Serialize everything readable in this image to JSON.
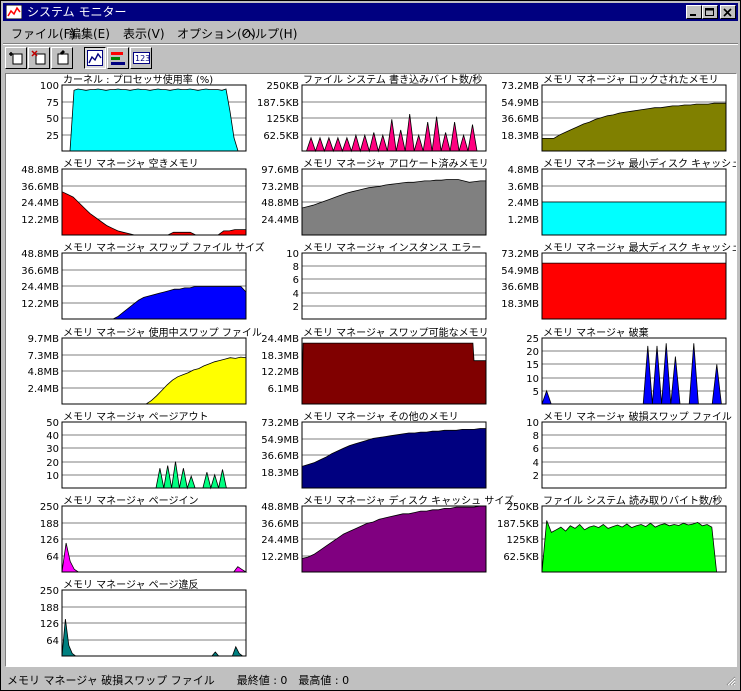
{
  "window": {
    "title": "システム モニター",
    "controls": [
      "minimize",
      "maximize",
      "close"
    ]
  },
  "menu": {
    "items": [
      "ファイル(F)",
      "編集(E)",
      "表示(V)",
      "オプション(O)",
      "ヘルプ(H)"
    ]
  },
  "toolbar": {
    "buttons": [
      "add-item",
      "remove-item",
      "edit-item",
      "line-chart-view",
      "bar-chart-view",
      "numeric-view"
    ],
    "active": "line-chart-view",
    "numeric_label": "123"
  },
  "status": {
    "text": "メモリ マネージャ 破損スワップ ファイル　　最終値 : 0　最高値 : 0"
  },
  "colors": {
    "cyan": "#00ffff",
    "pink": "#ff0080",
    "olive": "#808000",
    "red": "#ff0000",
    "gray": "#808080",
    "blue": "#0000ff",
    "maroon": "#800000",
    "yellow": "#ffff00",
    "navy": "#000080",
    "green": "#00ff80",
    "purple": "#800080",
    "lime": "#00ff00",
    "teal": "#008080",
    "magenta": "#ff00ff"
  },
  "chart_data": [
    {
      "type": "area",
      "title": "カーネル : プロセッサ使用率 (%)",
      "color": "cyan",
      "yticks": [
        "100",
        "75",
        "50",
        "25"
      ],
      "ylim": [
        0,
        100
      ],
      "values": [
        0,
        0,
        0,
        92,
        94,
        93,
        92,
        93,
        93,
        94,
        93,
        92,
        93,
        93,
        94,
        93,
        93,
        92,
        93,
        94,
        93,
        93,
        92,
        93,
        94,
        93,
        93,
        92,
        93,
        94,
        93,
        93,
        94,
        93,
        92,
        93,
        94,
        93,
        93,
        93,
        92,
        94,
        60,
        20,
        0,
        0,
        0
      ]
    },
    {
      "type": "area",
      "title": "ファイル システム 書き込みバイト数/秒",
      "color": "pink",
      "yticks": [
        "250KB",
        "187.5KB",
        "125KB",
        "62.5KB"
      ],
      "ylim": [
        0,
        250
      ],
      "values": [
        0,
        0,
        50,
        0,
        50,
        0,
        50,
        0,
        50,
        0,
        50,
        0,
        60,
        0,
        60,
        0,
        70,
        0,
        60,
        0,
        120,
        0,
        80,
        0,
        140,
        0,
        60,
        0,
        110,
        0,
        130,
        0,
        70,
        0,
        110,
        0,
        60,
        0,
        100,
        0,
        0,
        0
      ]
    },
    {
      "type": "area",
      "title": "メモリ マネージャ ロックされたメモリ",
      "color": "olive",
      "yticks": [
        "73.2MB",
        "54.9MB",
        "36.6MB",
        "18.3MB"
      ],
      "ylim": [
        0,
        73.2
      ],
      "values": [
        14,
        14,
        14,
        18,
        21,
        24,
        27,
        30,
        32,
        35,
        37,
        39,
        40,
        42,
        43,
        44,
        45,
        46,
        47,
        48,
        48,
        49,
        50,
        50,
        51,
        51,
        52,
        52,
        52,
        53,
        53,
        53
      ]
    },
    {
      "type": "area",
      "title": "メモリ マネージャ 空きメモリ",
      "color": "red",
      "yticks": [
        "48.8MB",
        "36.6MB",
        "24.4MB",
        "12.2MB"
      ],
      "ylim": [
        0,
        48.8
      ],
      "values": [
        32,
        30,
        28,
        24,
        20,
        16,
        13,
        10,
        7,
        5,
        3,
        2,
        1,
        0,
        0,
        0,
        0,
        0,
        0,
        0,
        2,
        2,
        2,
        2,
        0,
        0,
        0,
        0,
        0,
        3,
        3,
        4,
        4,
        4
      ]
    },
    {
      "type": "area",
      "title": "メモリ マネージャ アロケート済みメモリ",
      "color": "gray",
      "yticks": [
        "97.6MB",
        "73.2MB",
        "48.8MB",
        "24.4MB"
      ],
      "ylim": [
        0,
        97.6
      ],
      "values": [
        40,
        42,
        44,
        47,
        50,
        53,
        56,
        59,
        62,
        64,
        66,
        68,
        70,
        71,
        72,
        74,
        75,
        76,
        77,
        78,
        78,
        79,
        80,
        80,
        81,
        81,
        82,
        82,
        82,
        80,
        78,
        79,
        80,
        80
      ]
    },
    {
      "type": "area",
      "title": "メモリ マネージャ 最小ディスク キャッシュ サイズ",
      "color": "cyan",
      "yticks": [
        "4.8MB",
        "3.6MB",
        "2.4MB",
        "1.2MB"
      ],
      "ylim": [
        0,
        4.8
      ],
      "values": [
        2.4,
        2.4
      ]
    },
    {
      "type": "area",
      "title": "メモリ マネージャ スワップ ファイル サイズ",
      "color": "blue",
      "yticks": [
        "48.8MB",
        "36.6MB",
        "24.4MB",
        "12.2MB"
      ],
      "ylim": [
        0,
        48.8
      ],
      "values": [
        0,
        0,
        0,
        0,
        0,
        0,
        0,
        0,
        0,
        0,
        0,
        2,
        5,
        8,
        11,
        14,
        16,
        17,
        18,
        19,
        20,
        21,
        22,
        22,
        23,
        23,
        24,
        24,
        24,
        24,
        24,
        24,
        24,
        24,
        24,
        24,
        20
      ]
    },
    {
      "type": "area",
      "title": "メモリ マネージャ インスタンス エラー",
      "color": "gray",
      "yticks": [
        "10",
        "8",
        "6",
        "4",
        "2"
      ],
      "ylim": [
        0,
        10
      ],
      "values": []
    },
    {
      "type": "area",
      "title": "メモリ マネージャ 最大ディスク キャッシュ サイズ",
      "color": "red",
      "yticks": [
        "73.2MB",
        "54.9MB",
        "36.6MB",
        "18.3MB"
      ],
      "ylim": [
        0,
        73.2
      ],
      "values": [
        62,
        62
      ]
    },
    {
      "type": "area",
      "title": "メモリ マネージャ 使用中スワップ ファイル",
      "color": "yellow",
      "yticks": [
        "9.7MB",
        "7.3MB",
        "4.8MB",
        "2.4MB"
      ],
      "ylim": [
        0,
        9.7
      ],
      "values": [
        0,
        0,
        0,
        0,
        0,
        0,
        0,
        0,
        0,
        0,
        0,
        0,
        0,
        0,
        0,
        0,
        0,
        0.5,
        1.2,
        2,
        2.8,
        3.5,
        4,
        4.3,
        4.6,
        5,
        5.2,
        5.6,
        5.9,
        6.2,
        6.4,
        6.6,
        6.8,
        6.7,
        6.9,
        6.8
      ]
    },
    {
      "type": "area",
      "title": "メモリ マネージャ スワップ可能なメモリ",
      "color": "maroon",
      "yticks": [
        "24.4MB",
        "18.3MB",
        "12.2MB",
        "6.1MB"
      ],
      "ylim": [
        0,
        24.4
      ],
      "values": [
        0,
        22.5,
        22.5,
        22.5,
        22.5,
        22.5,
        22.5,
        22.5,
        22.5,
        22.5,
        22.5,
        22.5,
        22.5,
        22.5,
        22.5,
        22.5,
        22.5,
        22.5,
        22.5,
        22.5,
        22.5,
        22.5,
        22.5,
        22.5,
        22.5,
        22.5,
        22.5,
        22.5,
        22.5,
        22.5,
        22.5,
        22.5,
        22.5,
        22.5,
        22.5,
        22.5,
        22.5,
        22.5,
        22.5,
        22.5,
        22.5,
        22.5,
        22.5,
        22.5,
        22.5,
        22.5,
        22.5,
        22.5,
        22.5,
        22.5,
        22.5,
        22.5,
        22.5,
        22.5,
        22.5,
        22.5,
        22.5,
        22.5,
        22.5,
        22.5,
        22.5,
        22.5,
        22.5,
        22.5,
        22.5,
        22.5,
        22.5,
        22.5,
        22.5,
        22.5,
        22.5,
        22.5,
        22.5,
        22.5,
        22.5,
        22.5,
        22.5,
        22.5,
        22.5,
        22.5,
        22.5,
        22.5,
        22.5,
        22.5,
        22.5,
        22.5,
        22.5,
        22.5,
        22.5,
        22.5,
        22.5,
        22.5,
        22.5,
        22.5,
        22.5,
        22.5,
        22.5,
        22.5,
        22.5,
        22.5,
        22.5,
        22.5,
        22.5,
        22.5,
        22.5,
        22.5,
        22.5,
        22.5,
        22.5,
        22.5,
        22.5,
        22.5,
        22.5,
        22.5,
        22.5,
        22.5,
        22.5,
        22.5,
        22.5,
        22.5,
        22.5,
        22.5,
        22.5,
        22.5,
        22.5,
        22.5,
        22.5,
        22.5,
        22.5,
        22.5,
        22.5,
        22.5,
        22.5,
        22.5,
        22.5,
        22.5,
        22.5,
        22.5,
        22.5,
        22.5,
        22.5,
        22.5,
        22.5,
        22.5,
        22.5,
        22.5,
        22.5,
        22.5,
        22.5,
        22.5,
        22.5,
        22.5,
        22.5,
        22.5,
        22.5,
        22.5,
        22.5,
        16,
        16,
        16,
        16,
        16,
        16,
        16,
        16,
        16,
        16,
        16,
        16
      ]
    },
    {
      "type": "area",
      "title": "メモリ マネージャ 破棄",
      "color": "blue",
      "yticks": [
        "25",
        "20",
        "15",
        "10",
        "5"
      ],
      "ylim": [
        0,
        25
      ],
      "values": [
        0,
        5,
        0,
        0,
        0,
        0,
        0,
        0,
        0,
        0,
        0,
        0,
        0,
        0,
        0,
        0,
        0,
        0,
        0,
        0,
        0,
        0,
        0,
        22,
        0,
        22,
        0,
        23,
        0,
        18,
        0,
        0,
        0,
        23,
        0,
        0,
        0,
        0,
        15,
        0,
        0
      ]
    },
    {
      "type": "area",
      "title": "メモリ マネージャ ページアウト",
      "color": "green",
      "yticks": [
        "50",
        "40",
        "30",
        "20",
        "10"
      ],
      "ylim": [
        0,
        50
      ],
      "values": [
        0,
        0,
        0,
        0,
        0,
        0,
        0,
        0,
        0,
        0,
        0,
        0,
        0,
        0,
        0,
        0,
        0,
        0,
        0,
        0,
        0,
        0,
        0,
        0,
        0,
        15,
        0,
        17,
        0,
        20,
        0,
        15,
        0,
        9,
        0,
        0,
        0,
        12,
        0,
        10,
        0,
        14,
        0,
        0,
        0,
        0,
        0,
        0
      ]
    },
    {
      "type": "area",
      "title": "メモリ マネージャ その他のメモリ",
      "color": "navy",
      "yticks": [
        "73.2MB",
        "54.9MB",
        "36.6MB",
        "18.3MB"
      ],
      "ylim": [
        0,
        73.2
      ],
      "values": [
        24,
        26,
        28,
        31,
        34,
        38,
        41,
        44,
        47,
        49,
        51,
        53,
        55,
        56,
        57,
        58,
        59,
        60,
        61,
        61,
        62,
        62,
        63,
        63,
        64,
        64,
        64,
        65,
        65,
        65,
        66,
        66
      ]
    },
    {
      "type": "area",
      "title": "メモリ マネージャ 破損スワップ ファイル",
      "color": "gray",
      "yticks": [
        "10",
        "8",
        "6",
        "4",
        "2"
      ],
      "ylim": [
        0,
        10
      ],
      "values": []
    },
    {
      "type": "area",
      "title": "メモリ マネージャ ページイン",
      "color": "magenta",
      "yticks": [
        "250",
        "188",
        "126",
        "64"
      ],
      "ylim": [
        0,
        250
      ],
      "values": [
        0,
        110,
        40,
        10,
        0,
        0,
        0,
        0,
        0,
        0,
        0,
        0,
        0,
        0,
        0,
        0,
        0,
        0,
        0,
        0,
        0,
        0,
        0,
        0,
        0,
        0,
        0,
        0,
        0,
        0,
        0,
        0,
        0,
        0,
        0,
        0,
        0,
        0,
        0,
        0,
        0,
        0,
        0,
        20,
        10,
        0
      ]
    },
    {
      "type": "area",
      "title": "メモリ マネージャ ディスク キャッシュ サイズ",
      "color": "purple",
      "yticks": [
        "48.8MB",
        "36.6MB",
        "24.4MB",
        "12.2MB"
      ],
      "ylim": [
        0,
        48.8
      ],
      "values": [
        10,
        11,
        13,
        16,
        19,
        22,
        25,
        28,
        30,
        32,
        34,
        36,
        37,
        39,
        40,
        41,
        42,
        43,
        43,
        44,
        45,
        45,
        46,
        46,
        47,
        47,
        48,
        48,
        48,
        48,
        49,
        49
      ]
    },
    {
      "type": "area",
      "title": "ファイル システム 読み取りバイト数/秒",
      "color": "lime",
      "yticks": [
        "250KB",
        "187.5KB",
        "125KB",
        "62.5KB"
      ],
      "ylim": [
        0,
        250
      ],
      "values": [
        0,
        195,
        150,
        160,
        170,
        155,
        175,
        165,
        180,
        160,
        170,
        175,
        168,
        180,
        165,
        172,
        178,
        170,
        182,
        168,
        175,
        180,
        172,
        185,
        170,
        178,
        183,
        175,
        180,
        176,
        185,
        178,
        182,
        188,
        175,
        180,
        170,
        0,
        0,
        0
      ]
    },
    {
      "type": "area",
      "title": "メモリ マネージャ ページ違反",
      "color": "teal",
      "yticks": [
        "250",
        "188",
        "126",
        "64"
      ],
      "ylim": [
        0,
        250
      ],
      "values": [
        0,
        140,
        40,
        10,
        0,
        0,
        0,
        0,
        0,
        0,
        0,
        0,
        0,
        0,
        0,
        0,
        0,
        0,
        0,
        0,
        0,
        0,
        0,
        0,
        0,
        0,
        0,
        0,
        0,
        0,
        0,
        0,
        0,
        0,
        0,
        0,
        0,
        0,
        0,
        0,
        0,
        0,
        0,
        0,
        0,
        15,
        0,
        0,
        0,
        0,
        0,
        35,
        10,
        0,
        0
      ]
    }
  ]
}
